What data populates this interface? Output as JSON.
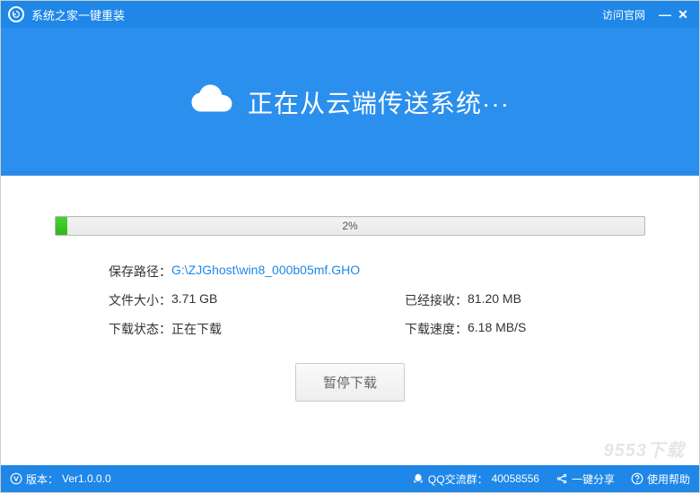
{
  "titlebar": {
    "app_name": "系统之家一键重装",
    "official_link": "访问官网"
  },
  "hero": {
    "status_text": "正在从云端传送系统···"
  },
  "progress": {
    "percent_text": "2%",
    "percent_value": 2
  },
  "info": {
    "path_label": "保存路径：",
    "path_value": "G:\\ZJGhost\\win8_000b05mf.GHO",
    "size_label": "文件大小：",
    "size_value": "3.71 GB",
    "received_label": "已经接收：",
    "received_value": "81.20 MB",
    "status_label": "下载状态：",
    "status_value": "正在下载",
    "speed_label": "下载速度：",
    "speed_value": "6.18 MB/S"
  },
  "actions": {
    "pause_label": "暂停下载"
  },
  "footer": {
    "version_label": "版本：",
    "version_value": "Ver1.0.0.0",
    "qq_label": "QQ交流群：",
    "qq_value": "40058556",
    "share_label": "一键分享",
    "help_label": "使用帮助"
  },
  "watermark": "9553下载"
}
